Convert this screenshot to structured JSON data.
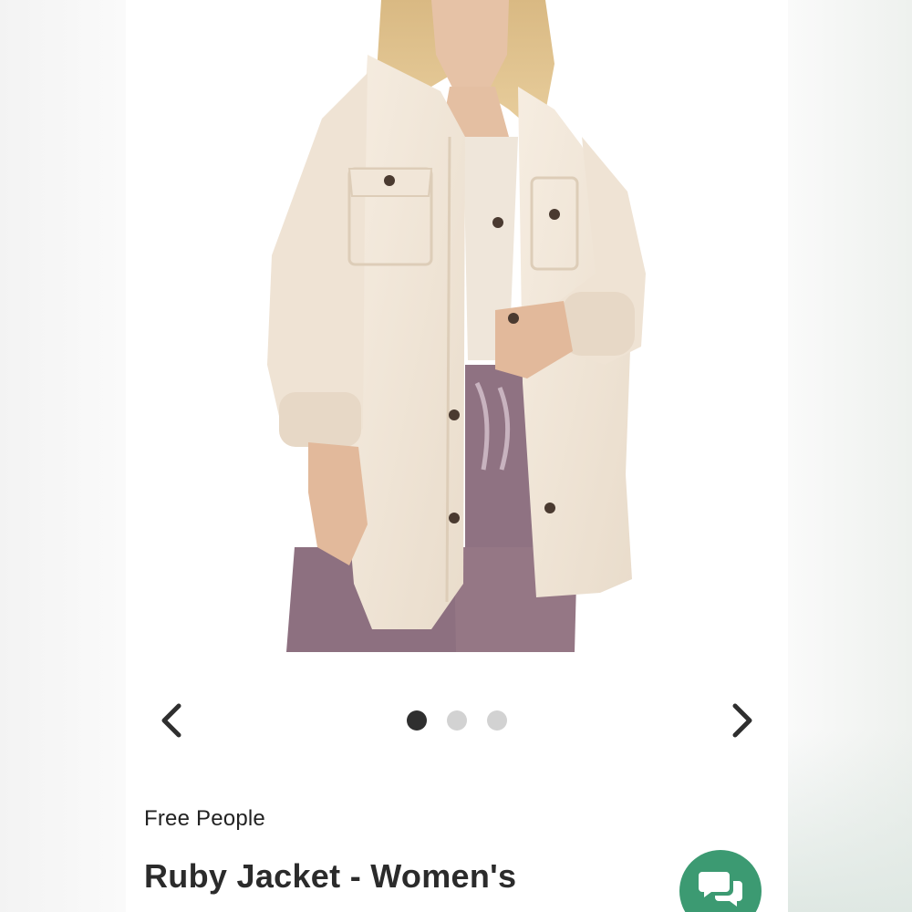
{
  "product": {
    "brand": "Free People",
    "title": "Ruby Jacket - Women's",
    "image_alt": "Oversized cream shirt jacket with flap chest pockets worn over mauve corduroy cargo pants"
  },
  "carousel": {
    "total_images": 3,
    "active_index": 0,
    "prev_icon": "chevron-left-icon",
    "next_icon": "chevron-right-icon"
  },
  "chat": {
    "icon": "chat-bubbles-icon",
    "color": "#3c9a72"
  },
  "colors": {
    "jacket": "#f3e8da",
    "pants": "#8d7080",
    "active_dot": "#2f2f2f",
    "inactive_dot": "#d2d2d2"
  }
}
